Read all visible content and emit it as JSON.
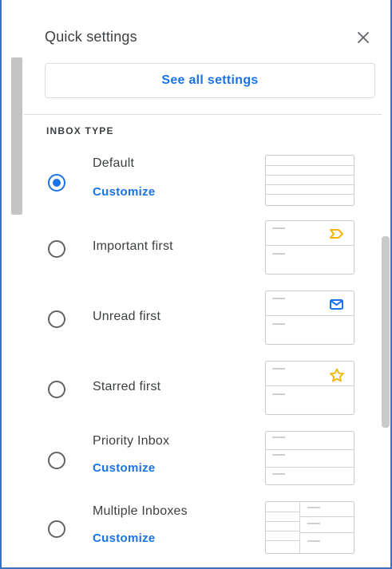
{
  "panel": {
    "title": "Quick settings",
    "close_icon": "close-icon",
    "see_all_label": "See all settings"
  },
  "section": {
    "label": "INBOX TYPE"
  },
  "inbox_types": [
    {
      "label": "Default",
      "customize": "Customize",
      "selected": true,
      "thumbnail": "default-layout"
    },
    {
      "label": "Important first",
      "selected": false,
      "thumbnail": "important-icon"
    },
    {
      "label": "Unread first",
      "selected": false,
      "thumbnail": "envelope-icon"
    },
    {
      "label": "Starred first",
      "selected": false,
      "thumbnail": "star-icon"
    },
    {
      "label": "Priority Inbox",
      "customize": "Customize",
      "selected": false,
      "thumbnail": "priority-layout"
    },
    {
      "label": "Multiple Inboxes",
      "customize": "Customize",
      "selected": false,
      "thumbnail": "multiple-layout"
    }
  ],
  "colors": {
    "accent_blue": "#1a73e8",
    "important_icon": "#f4b400",
    "unread_icon": "#1a73e8",
    "star_icon": "#f4b400"
  }
}
